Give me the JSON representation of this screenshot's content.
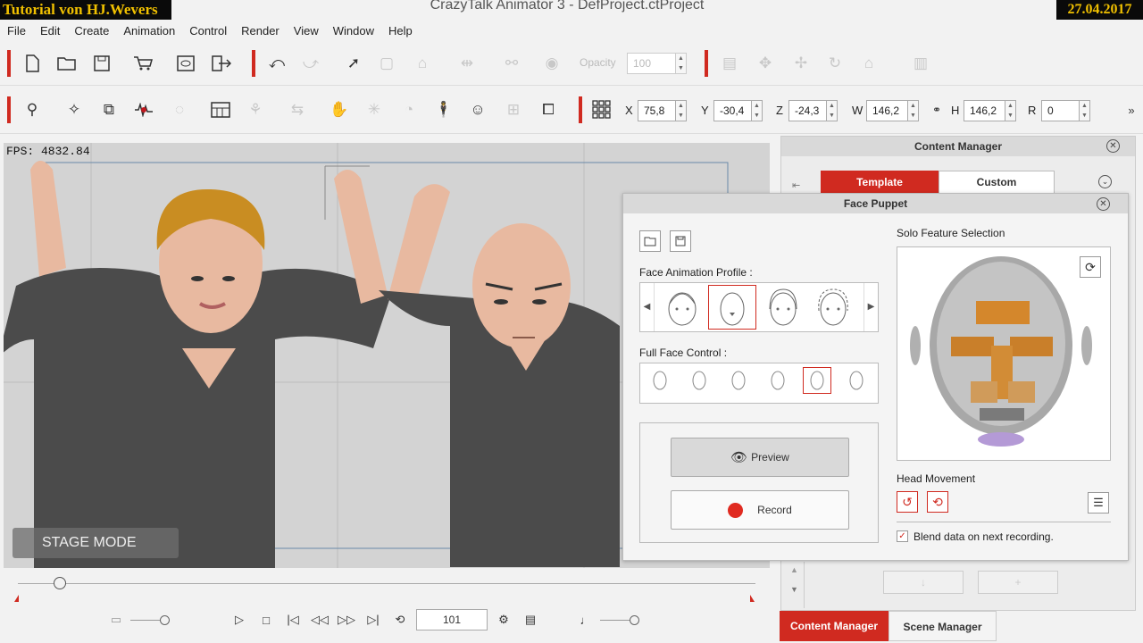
{
  "overlay": {
    "tutorial": "Tutorial von HJ.Wevers",
    "date": "27.04.2017"
  },
  "window": {
    "title": "CrazyTalk Animator 3    - DefProject.ctProject"
  },
  "menu": [
    "File",
    "Edit",
    "Create",
    "Animation",
    "Control",
    "Render",
    "View",
    "Window",
    "Help"
  ],
  "toolbar1": {
    "opacity_label": "Opacity",
    "opacity_value": "100"
  },
  "transform": {
    "x_label": "X",
    "x": "75,8",
    "y_label": "Y",
    "y": "-30,4",
    "z_label": "Z",
    "z": "-24,3",
    "w_label": "W",
    "w": "146,2",
    "h_label": "H",
    "h": "146,2",
    "r_label": "R",
    "r": "0"
  },
  "stage": {
    "fps": "FPS: 4832.84",
    "mode": "STAGE MODE"
  },
  "content_manager": {
    "title": "Content Manager",
    "tabs": [
      "Template",
      "Custom"
    ]
  },
  "face_puppet": {
    "title": "Face Puppet",
    "profile_label": "Face Animation Profile :",
    "full_face_label": "Full Face Control :",
    "preview_label": "Preview",
    "record_label": "Record",
    "solo_label": "Solo Feature Selection",
    "head_movement_label": "Head Movement",
    "blend_label": "Blend data on next recording.",
    "blend_checked": true
  },
  "timeline": {
    "frame": "101"
  },
  "bottom_tabs": [
    "Content Manager",
    "Scene Manager"
  ],
  "colors": {
    "accent": "#d02a20",
    "record": "#e02a20"
  }
}
